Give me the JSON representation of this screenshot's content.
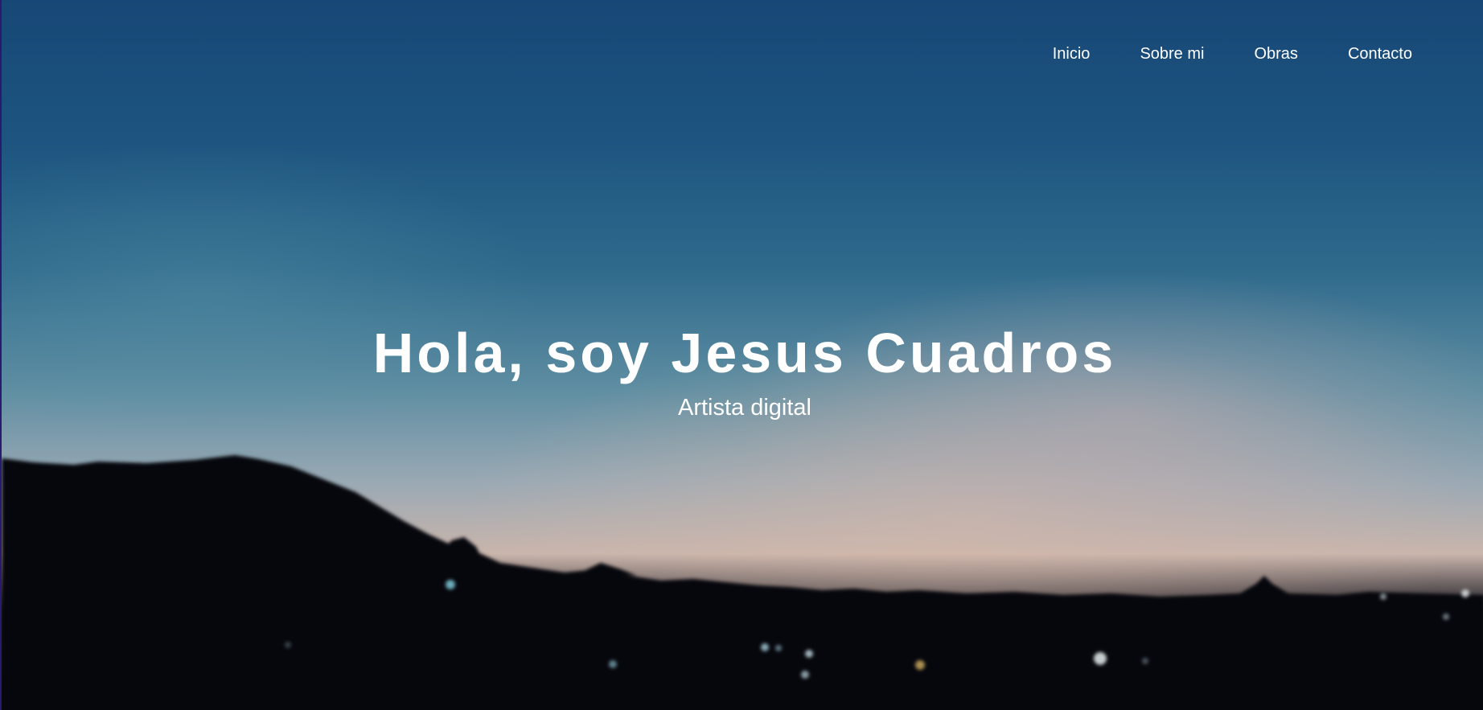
{
  "nav": {
    "items": [
      "Inicio",
      "Sobre mi",
      "Obras",
      "Contacto"
    ]
  },
  "hero": {
    "title": "Hola, soy Jesus Cuadros",
    "subtitle": "Artista digital"
  },
  "colors": {
    "sky_top": "#174776",
    "sky_mid": "#5f8ea2",
    "horizon_glow": "#c9b5ac",
    "ground": "#07080f",
    "text": "#ffffff"
  }
}
